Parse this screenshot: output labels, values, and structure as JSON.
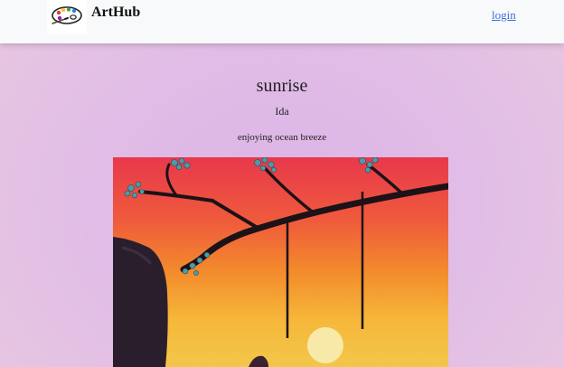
{
  "navbar": {
    "brand": "ArtHub",
    "logo_icon": "palette-icon",
    "login_label": "login"
  },
  "artwork": {
    "title": "sunrise",
    "artist": "Ida",
    "description": "enjoying ocean breeze",
    "image_icon": "painting-image"
  },
  "colors": {
    "navbar_bg": "#f8f9fa",
    "link": "#3b6fd8",
    "page_bg": "#dcb4e6"
  }
}
